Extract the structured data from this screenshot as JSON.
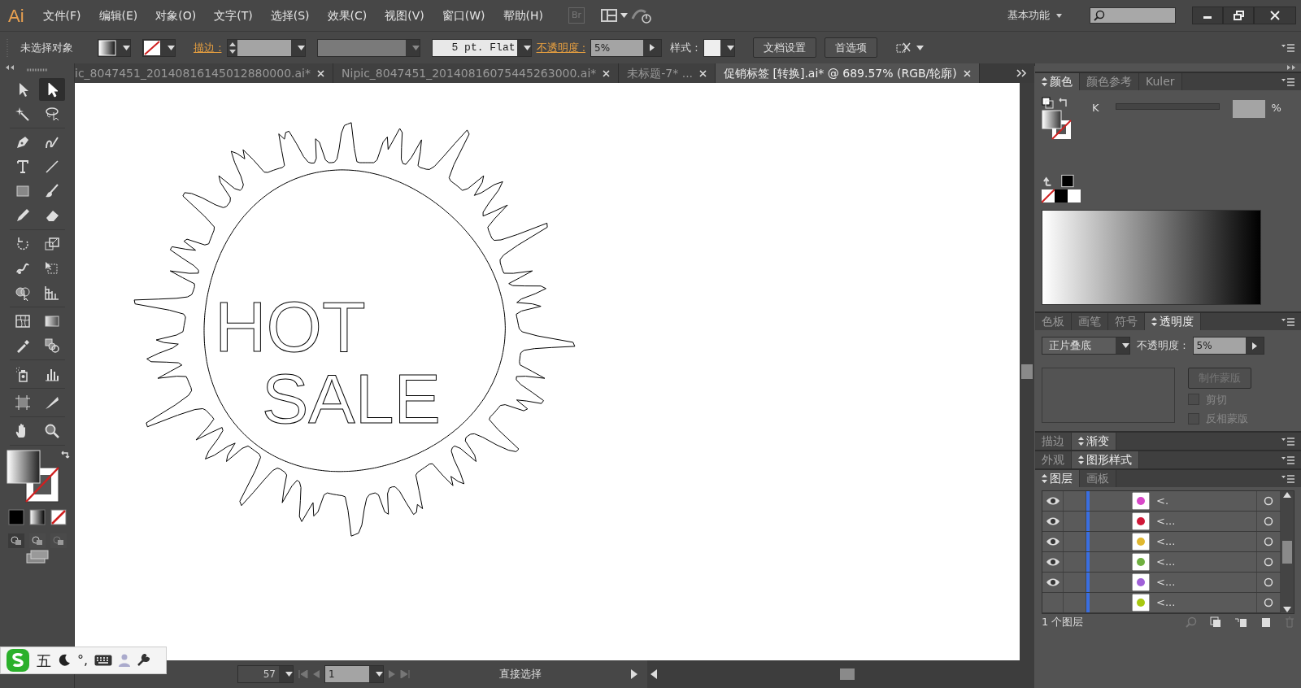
{
  "app": {
    "logo": "Ai",
    "bridge": "Br",
    "workspace": "基本功能"
  },
  "menu": [
    "文件(F)",
    "编辑(E)",
    "对象(O)",
    "文字(T)",
    "选择(S)",
    "效果(C)",
    "视图(V)",
    "窗口(W)",
    "帮助(H)"
  ],
  "control_bar": {
    "selection": "未选择对象",
    "stroke_label": "描边 :",
    "stroke_profile": "5 pt. Flat",
    "opacity_label": "不透明度 :",
    "opacity": "5%",
    "style_label": "样式 :",
    "buttons": [
      "文档设置",
      "首选项"
    ]
  },
  "doc_tabs": [
    {
      "label": "ic_8047451_20140816145012880000.ai*",
      "selected": false
    },
    {
      "label": "Nipic_8047451_20140816075445263000.ai*",
      "selected": false
    },
    {
      "label": "未标题-7* ...",
      "selected": false
    },
    {
      "label": "促销标签  [转换].ai* @ 689.57% (RGB/轮廓)",
      "selected": true
    }
  ],
  "tools": [
    {
      "kind": "selection",
      "selected": false
    },
    {
      "kind": "direct-selection",
      "selected": true
    },
    {
      "kind": "magic-wand",
      "selected": false
    },
    {
      "kind": "lasso",
      "selected": false
    },
    {
      "kind": "pen",
      "selected": false
    },
    {
      "kind": "pen-curve",
      "selected": false
    },
    {
      "kind": "type",
      "selected": false
    },
    {
      "kind": "line",
      "selected": false
    },
    {
      "kind": "rectangle",
      "selected": false
    },
    {
      "kind": "brush",
      "selected": false
    },
    {
      "kind": "pencil",
      "selected": false
    },
    {
      "kind": "eraser",
      "selected": false
    },
    {
      "kind": "rotate",
      "selected": false
    },
    {
      "kind": "scale",
      "selected": false
    },
    {
      "kind": "warp",
      "selected": false
    },
    {
      "kind": "free-transform",
      "selected": false
    },
    {
      "kind": "shape-builder",
      "selected": false
    },
    {
      "kind": "perspective",
      "selected": false
    },
    {
      "kind": "mesh",
      "selected": false
    },
    {
      "kind": "gradient",
      "selected": false
    },
    {
      "kind": "eyedropper",
      "selected": false
    },
    {
      "kind": "blend",
      "selected": false
    },
    {
      "kind": "sprayer",
      "selected": false
    },
    {
      "kind": "graph",
      "selected": false
    },
    {
      "kind": "artboard",
      "selected": false
    },
    {
      "kind": "knife",
      "selected": false
    },
    {
      "kind": "hand",
      "selected": false
    },
    {
      "kind": "zoom",
      "selected": false
    }
  ],
  "canvas": {
    "artwork_text": [
      "HOT",
      "SALE"
    ]
  },
  "status": {
    "zoom": "57",
    "page": "1",
    "tool": "直接选择"
  },
  "color_panel": {
    "tabs": [
      {
        "label": "颜色",
        "selected": true
      },
      {
        "label": "颜色参考",
        "selected": false
      },
      {
        "label": "Kuler",
        "selected": false
      }
    ],
    "channel": "K",
    "unit": "%"
  },
  "transparency_panel": {
    "tabs": [
      {
        "label": "色板",
        "selected": false
      },
      {
        "label": "画笔",
        "selected": false
      },
      {
        "label": "符号",
        "selected": false
      },
      {
        "label": "透明度",
        "selected": true
      }
    ],
    "blend_mode": "正片叠底",
    "opacity_label": "不透明度 :",
    "opacity": "5%",
    "mask_button": {
      "label": "制作蒙版",
      "disabled": true
    },
    "options": [
      {
        "label": "剪切",
        "checked": false
      },
      {
        "label": "反相蒙版",
        "checked": false
      }
    ]
  },
  "stroke_tabs": [
    {
      "label": "描边",
      "selected": false
    },
    {
      "label": "渐变",
      "selected": true
    }
  ],
  "appearance_tabs": [
    {
      "label": "外观",
      "selected": false
    },
    {
      "label": "图形样式",
      "selected": true
    }
  ],
  "layers_panel": {
    "tabs": [
      {
        "label": "图层",
        "selected": true
      },
      {
        "label": "画板",
        "selected": false
      }
    ],
    "rows": [
      {
        "visible": true,
        "color": "#d848c8",
        "label": "<."
      },
      {
        "visible": true,
        "color": "#d01838",
        "label": "<..."
      },
      {
        "visible": true,
        "color": "#e0b830",
        "label": "<..."
      },
      {
        "visible": true,
        "color": "#70b040",
        "label": "<..."
      },
      {
        "visible": true,
        "color": "#a060d8",
        "label": "<..."
      },
      {
        "visible": false,
        "color": "#a8c810",
        "label": "<..."
      }
    ],
    "footer": "1 个图层"
  },
  "ime": {
    "mode": "五",
    "punct": "°,"
  }
}
